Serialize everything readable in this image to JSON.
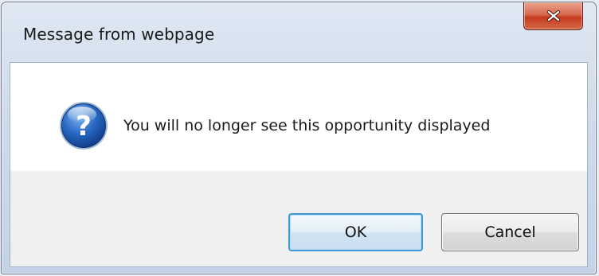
{
  "dialog": {
    "title": "Message from webpage",
    "message": "You will no longer see this opportunity displayed",
    "icon": "question-icon",
    "close_icon": "close-icon",
    "buttons": {
      "ok_label": "OK",
      "cancel_label": "Cancel"
    }
  },
  "colors": {
    "close_button": "#c4391f",
    "ok_focus_border": "#3c9ad8",
    "icon_blue": "#1a5bb5"
  }
}
